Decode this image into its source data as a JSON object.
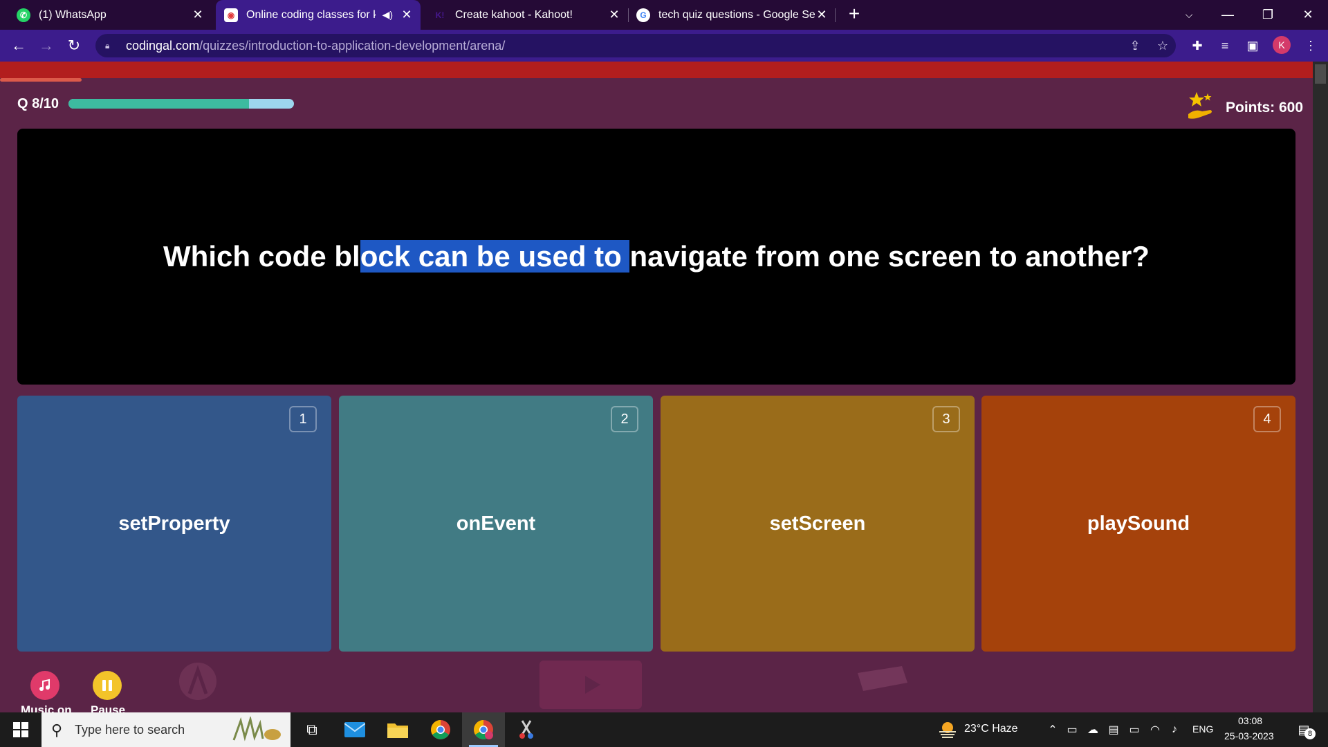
{
  "browser": {
    "tabs": [
      {
        "title": "(1) WhatsApp",
        "icon": "whatsapp-icon"
      },
      {
        "title": "Online coding classes for kid",
        "icon": "codingal-icon",
        "audio": true
      },
      {
        "title": "Create kahoot - Kahoot!",
        "icon": "kahoot-icon",
        "favicon_text": "K!"
      },
      {
        "title": "tech quiz questions - Google Sea",
        "icon": "google-icon",
        "favicon_text": "G"
      }
    ],
    "url_host": "codingal.com",
    "url_path": "/quizzes/introduction-to-application-development/arena/",
    "profile_initial": "K"
  },
  "quiz": {
    "counter": "Q 8/10",
    "progress_fraction": 0.8,
    "points": "Points: 600",
    "question": {
      "before": "Which code bl",
      "selected": "ock can be used to ",
      "after": "navigate from one screen to another?"
    },
    "answers": [
      {
        "label": "setProperty",
        "number": "1",
        "color": "#33578a"
      },
      {
        "label": "onEvent",
        "number": "2",
        "color": "#417b84"
      },
      {
        "label": "setScreen",
        "number": "3",
        "color": "#9a6c1a"
      },
      {
        "label": "playSound",
        "number": "4",
        "color": "#a5420b"
      }
    ],
    "controls": {
      "music_label": "Music on",
      "pause_label": "Pause"
    }
  },
  "taskbar": {
    "search_placeholder": "Type here to search",
    "weather": "23°C  Haze",
    "language": "ENG",
    "time": "03:08",
    "date": "25-03-2023",
    "notification_count": "8"
  }
}
